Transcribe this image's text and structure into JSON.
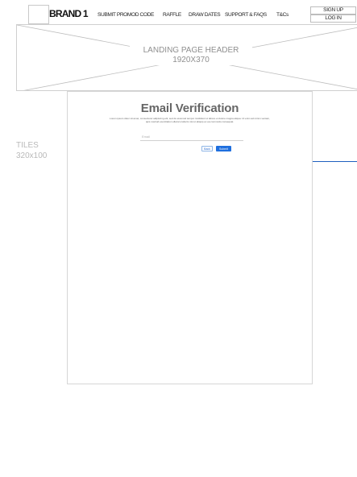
{
  "nav": {
    "brand": "BRAND 1",
    "items": [
      "SUBMIT PROMOD CODE",
      "RAFFLE",
      "DRAW DATES",
      "SUPPORT & FAQS",
      "T&Cs"
    ],
    "auth": {
      "signup": "SIGN UP",
      "login": "LOG IN"
    }
  },
  "header": {
    "line1": "LANDING PAGE HEADER",
    "line2": "1920X370"
  },
  "tiles": {
    "label": "TILES\n320x100"
  },
  "verification": {
    "title": "Email Verification",
    "description": "Lorem ipsum dolor sit amet, consectetur adipiscing elit, sed do eiusmod tempor incididunt ut labore et dolore magna aliqua. Ut enim ad minim veniam, quis nostrud exercitation ullamco laboris nisi ut aliquip ex ea commodo consequat.",
    "email_placeholder": "Email",
    "back_label": "Back",
    "submit_label": "Submit"
  },
  "colors": {
    "accent": "#1f6fde",
    "link_line": "#1f5fbf",
    "wireframe_border": "#cfcfcf"
  }
}
